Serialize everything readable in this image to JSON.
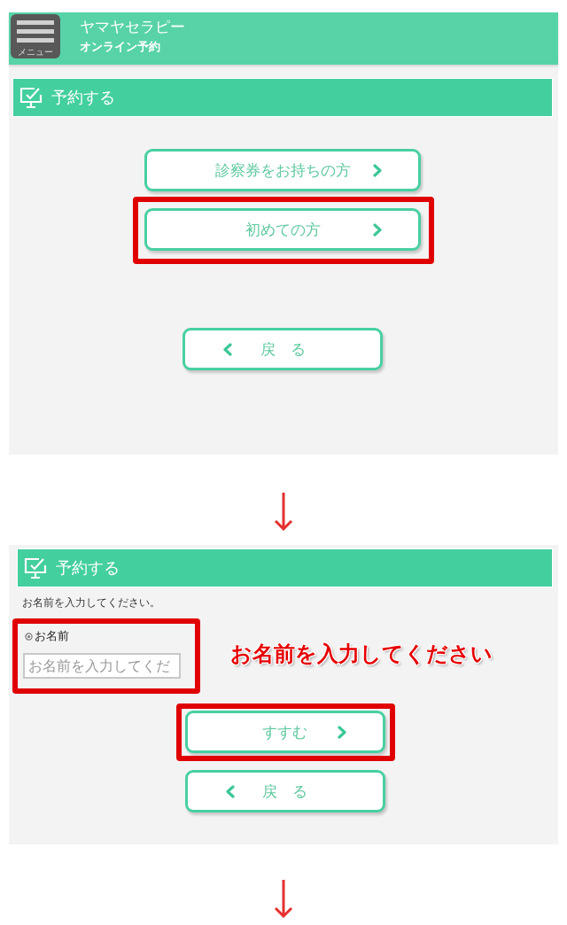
{
  "screens": [
    {
      "header": {
        "menu_label": "メニュー",
        "title": "ヤマヤセラピー",
        "subtitle": "オンライン予約"
      },
      "section_title": "予約する",
      "buttons": [
        {
          "kind": "option",
          "label": "診察券をお持ちの方",
          "highlighted": false
        },
        {
          "kind": "option",
          "label": "初めての方",
          "highlighted": true
        },
        {
          "kind": "back",
          "label": "戻　る",
          "highlighted": false
        }
      ]
    },
    {
      "section_title": "予約する",
      "instruction": "お名前を入力してください。",
      "name_field": {
        "label": "お名前",
        "placeholder": "お名前を入力してくだ",
        "highlighted": true,
        "callout": "お名前を入力してください"
      },
      "buttons": [
        {
          "kind": "next",
          "label": "すすむ",
          "highlighted": true
        },
        {
          "kind": "back",
          "label": "戻　る",
          "highlighted": false
        }
      ]
    }
  ]
}
